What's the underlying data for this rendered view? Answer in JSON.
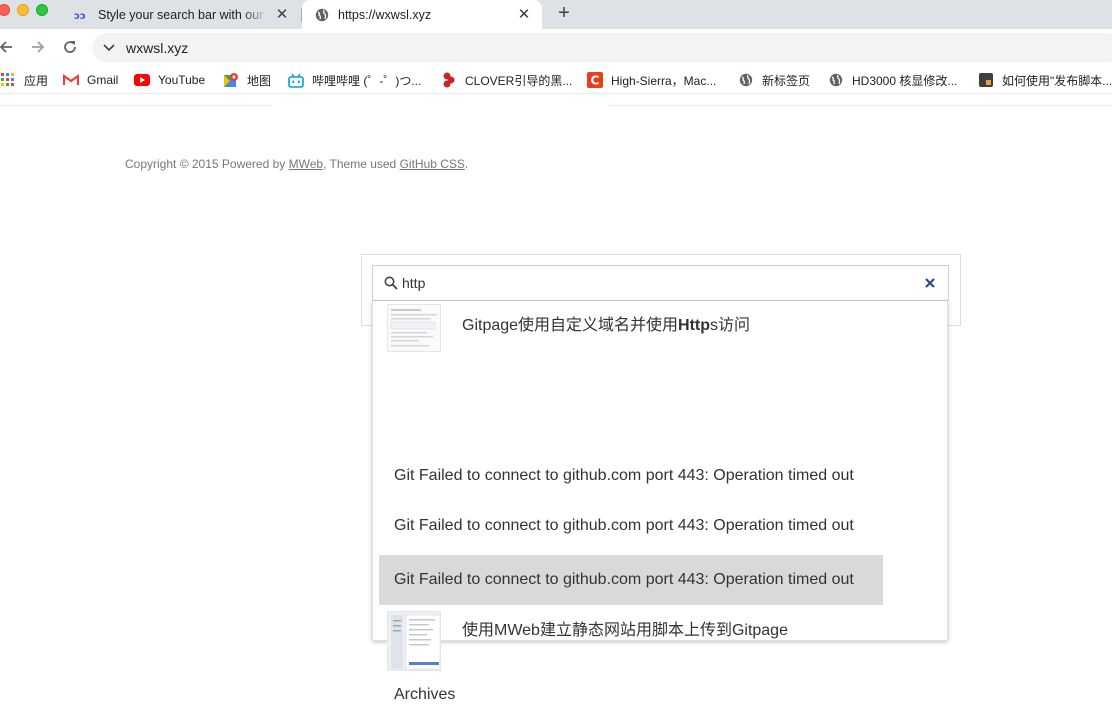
{
  "browser": {
    "tabs": [
      {
        "title": "Style your search bar with our",
        "favicon": "stylebar-favicon-icon"
      },
      {
        "title": "https://wxwsl.xyz",
        "favicon": "globe-icon"
      }
    ],
    "url": "wxwsl.xyz",
    "bookmarks": [
      {
        "label": "应用",
        "icon": "apps-grid-icon"
      },
      {
        "label": "Gmail",
        "icon": "gmail-icon"
      },
      {
        "label": "YouTube",
        "icon": "youtube-icon"
      },
      {
        "label": "地图",
        "icon": "maps-icon"
      },
      {
        "label": "哔哩哔哩 (゜-゜)つ...",
        "icon": "bilibili-icon"
      },
      {
        "label": "CLOVER引导的黑...",
        "icon": "clover-icon"
      },
      {
        "label": "High-Sierra，Mac...",
        "icon": "c-logo-icon"
      },
      {
        "label": "新标签页",
        "icon": "globe-icon"
      },
      {
        "label": "HD3000 核显修改...",
        "icon": "globe-icon"
      },
      {
        "label": "如何使用\"发布脚本...",
        "icon": "script-icon"
      }
    ]
  },
  "page": {
    "copyright_prefix": "Copyright © 2015 Powered by ",
    "mweb_link": "MWeb",
    "theme_text": ",  Theme used ",
    "github_css_link": "GitHub CSS",
    "period": "."
  },
  "search": {
    "query": "http",
    "results": [
      {
        "before": "Gitpage使用自定义域名并使用",
        "match": "Http",
        "after": "s访问",
        "has_thumb": true
      },
      {
        "title": "Git Failed to connect to github.com port 443: Operation timed out",
        "has_thumb": false
      },
      {
        "title": "Git Failed to connect to github.com port 443: Operation timed out",
        "has_thumb": false
      },
      {
        "title": "Git Failed to connect to github.com port 443: Operation timed out",
        "has_thumb": false,
        "highlighted": true
      },
      {
        "title": "使用MWeb建立静态网站用脚本上传到Gitpage",
        "has_thumb": true
      },
      {
        "title": "Archives",
        "has_thumb": false
      }
    ]
  },
  "colors": {
    "tabstrip": "#dee1e6",
    "highlight": "#d9d9d9",
    "clear_icon": "#2c4a8c"
  }
}
